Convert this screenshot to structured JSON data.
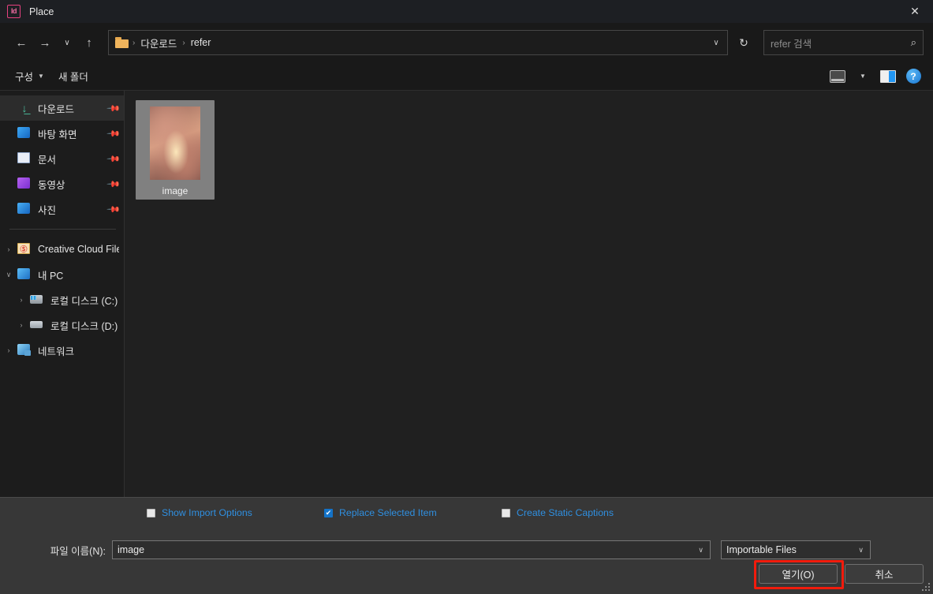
{
  "window": {
    "app_badge": "Id",
    "title": "Place",
    "close_label": "✕"
  },
  "nav": {
    "back": "←",
    "forward": "→",
    "recent": "∨",
    "up": "↑",
    "refresh": "↻",
    "address_chevron": "∨",
    "breadcrumbs": [
      "다운로드",
      "refer"
    ],
    "separator": "›",
    "search": {
      "placeholder": "refer 검색",
      "icon": "⌕"
    }
  },
  "command_bar": {
    "organize_label": "구성",
    "organize_caret": "▼",
    "new_folder_label": "새 폴더",
    "view_caret": "▼",
    "help_label": "?"
  },
  "sidebar": {
    "quick_access": [
      {
        "label": "다운로드",
        "icon": "download-icon",
        "pinned": true,
        "selected": true
      },
      {
        "label": "바탕 화면",
        "icon": "desktop-icon",
        "pinned": true,
        "selected": false
      },
      {
        "label": "문서",
        "icon": "documents-icon",
        "pinned": true,
        "selected": false
      },
      {
        "label": "동영상",
        "icon": "videos-icon",
        "pinned": true,
        "selected": false
      },
      {
        "label": "사진",
        "icon": "pictures-icon",
        "pinned": true,
        "selected": false
      }
    ],
    "tree": [
      {
        "label": "Creative Cloud File",
        "icon": "creative-cloud-icon",
        "expander": "›",
        "indent": 1
      },
      {
        "label": "내 PC",
        "icon": "this-pc-icon",
        "expander": "∨",
        "indent": 1
      },
      {
        "label": "로컬 디스크 (C:)",
        "icon": "disk-c-icon",
        "expander": "›",
        "indent": 2
      },
      {
        "label": "로컬 디스크 (D:)",
        "icon": "disk-d-icon",
        "expander": "›",
        "indent": 2
      },
      {
        "label": "네트워크",
        "icon": "network-icon",
        "expander": "›",
        "indent": 1
      }
    ],
    "pin_glyph": "📌"
  },
  "files": [
    {
      "name": "image",
      "selected": true
    }
  ],
  "import_options": [
    {
      "label": "Show Import Options",
      "checked": false
    },
    {
      "label": "Replace Selected Item",
      "checked": true
    },
    {
      "label": "Create Static Captions",
      "checked": false
    }
  ],
  "filename": {
    "label": "파일 이름(N):",
    "value": "image",
    "chevron": "∨"
  },
  "filetype": {
    "value": "Importable Files",
    "chevron": "∨"
  },
  "buttons": {
    "open": "열기(O)",
    "cancel": "취소"
  },
  "colors": {
    "accent_blue": "#2f8fe0",
    "checkbox_checked": "#1473c8",
    "highlight_red": "#f21b0c",
    "brand_pink": "#e6417f",
    "selection_gray": "#808080"
  },
  "checkmark": "✔"
}
